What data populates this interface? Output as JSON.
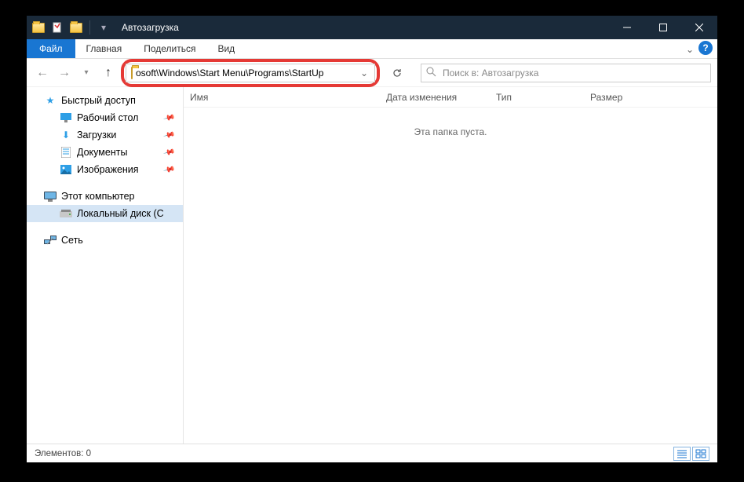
{
  "title": "Автозагрузка",
  "ribbon": {
    "file": "Файл",
    "tabs": [
      "Главная",
      "Поделиться",
      "Вид"
    ]
  },
  "address": {
    "path": "osoft\\Windows\\Start Menu\\Programs\\StartUp"
  },
  "search": {
    "placeholder": "Поиск в: Автозагрузка"
  },
  "sidebar": {
    "quick_access": "Быстрый доступ",
    "items": [
      {
        "label": "Рабочий стол",
        "pinned": true
      },
      {
        "label": "Загрузки",
        "pinned": true
      },
      {
        "label": "Документы",
        "pinned": true
      },
      {
        "label": "Изображения",
        "pinned": true
      }
    ],
    "this_pc": "Этот компьютер",
    "drive": "Локальный диск (C",
    "network": "Сеть"
  },
  "columns": {
    "name": "Имя",
    "date": "Дата изменения",
    "type": "Тип",
    "size": "Размер"
  },
  "empty": "Эта папка пуста.",
  "status": "Элементов: 0"
}
